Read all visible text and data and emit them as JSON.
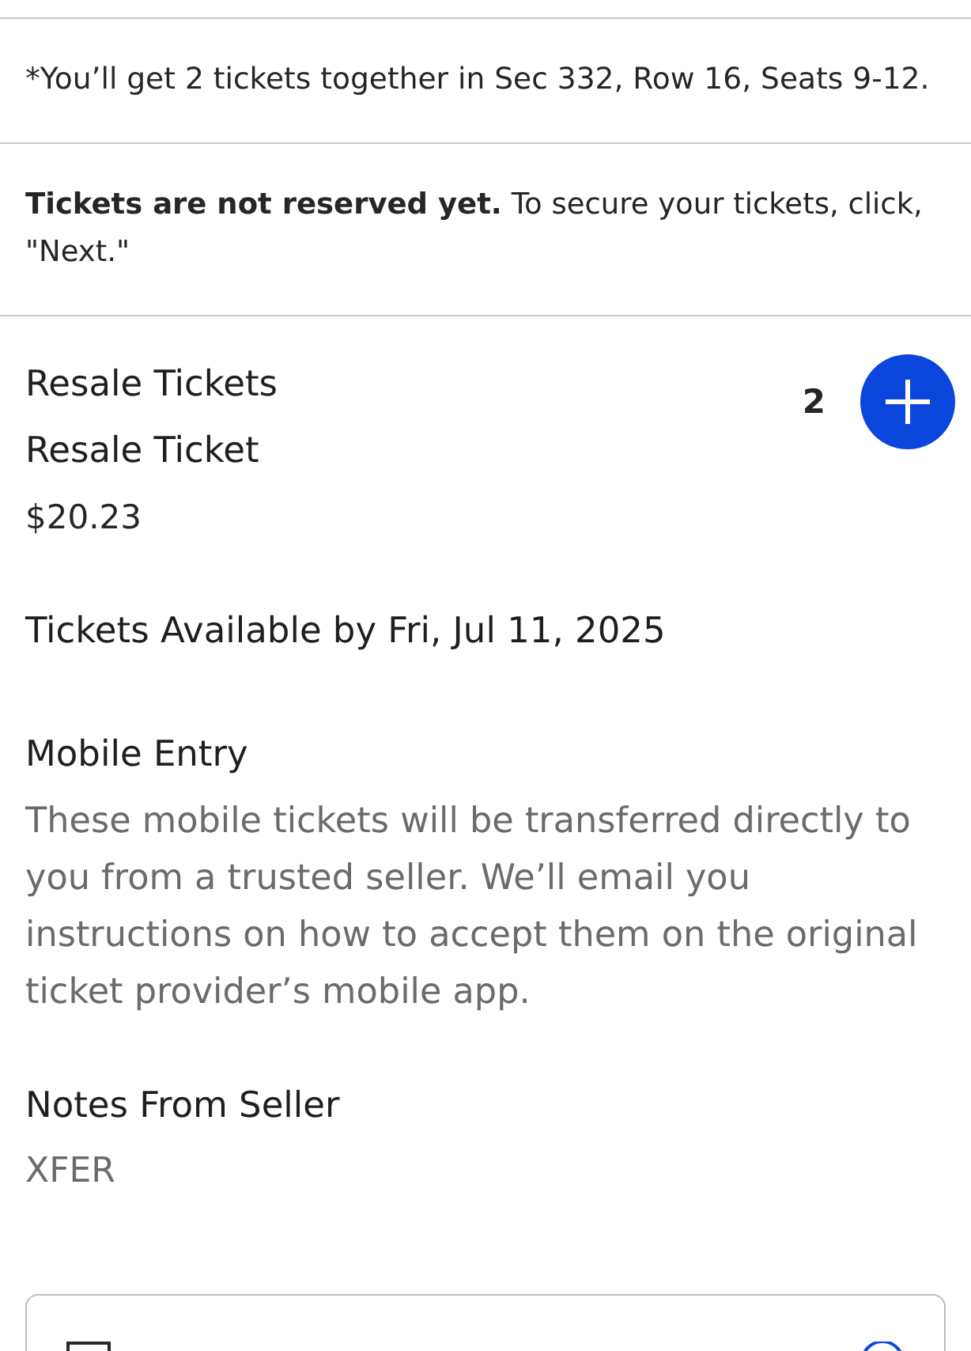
{
  "notice": {
    "text": "*You’ll get 2 tickets together in Sec 332, Row 16, Seats 9-12."
  },
  "reservation_note": {
    "text": "**Tickets are not reserved yet.** To secure your tickets, click, \"Next.\""
  },
  "listing": {
    "title": "Resale Tickets",
    "ticket_type": "Resale Ticket",
    "price": "$20.23",
    "quantity": "2"
  },
  "availability": {
    "text": "Tickets Available by Fri, Jul 11, 2025"
  },
  "delivery": {
    "title": "Mobile Entry",
    "description": "These mobile tickets will be transferred directly to you from a trusted seller. We’ll email you instructions on how to accept them on the original ticket provider’s mobile app."
  },
  "seller_notes": {
    "title": "Notes From Seller",
    "text": "XFER"
  },
  "option_card": {
    "checked": false
  }
}
